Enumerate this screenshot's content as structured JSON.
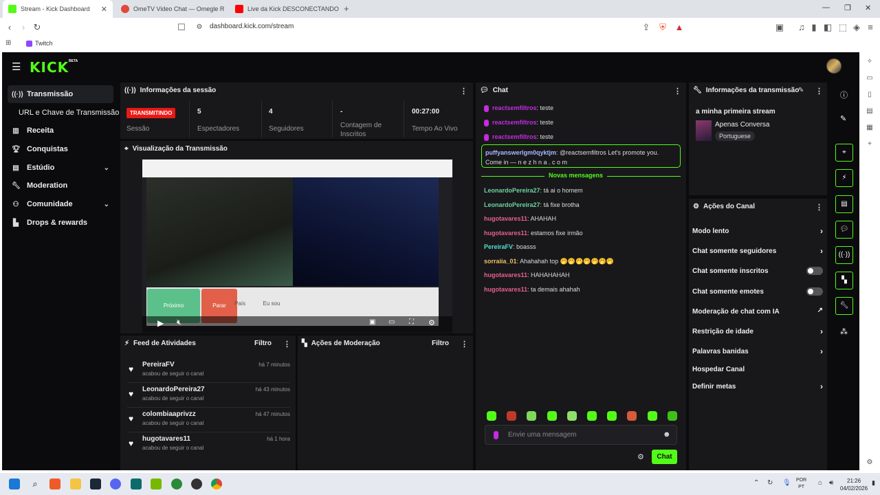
{
  "browser": {
    "tabs": [
      {
        "title": "Stream - Kick Dashboard",
        "active": true
      },
      {
        "title": "OmeTV Video Chat — Omegle R",
        "active": false
      },
      {
        "title": "Live da Kick DESCONECTANDO ou T",
        "active": false
      }
    ],
    "new_tab": "+",
    "url": "dashboard.kick.com/stream",
    "bookmark": "Twitch"
  },
  "app": {
    "logo": "KICK",
    "beta": "BETA"
  },
  "sidebar": {
    "items": [
      {
        "label": "Transmissão",
        "icon": "broadcast-icon"
      },
      {
        "label": "URL e Chave de Transmissão",
        "icon": ""
      },
      {
        "label": "Receita",
        "icon": "chart-icon"
      },
      {
        "label": "Conquistas",
        "icon": "trophy-icon"
      },
      {
        "label": "Estúdio",
        "icon": "studio-icon"
      },
      {
        "label": "Moderation",
        "icon": "wrench-icon"
      },
      {
        "label": "Comunidade",
        "icon": "community-icon"
      },
      {
        "label": "Drops & rewards",
        "icon": "drops-icon"
      }
    ]
  },
  "session": {
    "title": "Informações da sessão",
    "status_badge": "TRANSMITINDO",
    "status_label": "Sessão",
    "stats": [
      {
        "value": "5",
        "label": "Espectadores"
      },
      {
        "value": "4",
        "label": "Seguidores"
      },
      {
        "value": "-",
        "label": "Contagem de Inscritos"
      },
      {
        "value": "00:27:00",
        "label": "Tempo Ao Vivo"
      }
    ]
  },
  "preview": {
    "title": "Visualização da Transmissão",
    "buttons": [
      "Próximo",
      "Parar",
      "País",
      "Eu sou"
    ]
  },
  "activity": {
    "title": "Feed de Atividades",
    "filter": "Filtro",
    "items": [
      {
        "name": "PereiraFV",
        "desc": "acabou de seguir o canal",
        "time": "há 7 minutos"
      },
      {
        "name": "LeonardoPereira27",
        "desc": "acabou de seguir o canal",
        "time": "há 43 minutos"
      },
      {
        "name": "colombiaaprivzz",
        "desc": "acabou de seguir o canal",
        "time": "há 47 minutos"
      },
      {
        "name": "hugotavares11",
        "desc": "acabou de seguir o canal",
        "time": "há 1 hora"
      }
    ]
  },
  "moderation": {
    "title": "Ações de Moderação",
    "filter": "Filtro"
  },
  "chat": {
    "title": "Chat",
    "messages_top": [
      {
        "user": "reactsemfiltros",
        "text": "teste"
      },
      {
        "user": "reactsemfiltros",
        "text": "teste"
      },
      {
        "user": "reactsemfiltros",
        "text": "teste"
      }
    ],
    "highlight": {
      "user": "puffyanswerlgm0qyktjm",
      "text": "@reactsemfiltros Let's promote you.",
      "text2": "Come in — n e z h n a . c o m"
    },
    "divider": "Novas mensagens",
    "messages": [
      {
        "user": "LeonardoPereira27",
        "text": "tá ai o homem",
        "color": "#6fd0a0"
      },
      {
        "user": "LeonardoPereira27",
        "text": "tá fixe brotha",
        "color": "#6fd0a0"
      },
      {
        "user": "hugotavares11",
        "text": "AHAHAH",
        "color": "#e8608a"
      },
      {
        "user": "hugotavares11",
        "text": "estamos fixe irmão",
        "color": "#e8608a"
      },
      {
        "user": "PereiraFV",
        "text": "boasss",
        "color": "#53e0d0"
      },
      {
        "user": "sorraiia_01",
        "text": "Ahahahah top 🤭🤭🤭🤭🤭🤭🤭",
        "color": "#f0c060"
      },
      {
        "user": "hugotavares11",
        "text": "HAHAHAHAH",
        "color": "#e8608a"
      },
      {
        "user": "hugotavares11",
        "text": "ta demais ahahah",
        "color": "#e8608a"
      }
    ],
    "input_placeholder": "Envie uma mensagem",
    "send_label": "Chat"
  },
  "stream_info": {
    "title": "Informações da transmissão",
    "stream_title": "a minha primeira stream",
    "category": "Apenas Conversa",
    "language": "Portuguese"
  },
  "channel_actions": {
    "title": "Ações do Canal",
    "items": [
      {
        "label": "Modo lento",
        "control": "chevron"
      },
      {
        "label": "Chat somente seguidores",
        "control": "chevron"
      },
      {
        "label": "Chat somente inscritos",
        "control": "toggle"
      },
      {
        "label": "Chat somente emotes",
        "control": "toggle"
      },
      {
        "label": "Moderação de chat com IA",
        "control": "external"
      },
      {
        "label": "Restrição de idade",
        "control": "chevron"
      },
      {
        "label": "Palavras banidas",
        "control": "chevron"
      },
      {
        "label": "Hospedar Canal",
        "control": "none"
      },
      {
        "label": "Definir metas",
        "control": "chevron"
      }
    ]
  },
  "taskbar": {
    "lang_top": "POR",
    "lang_bottom": "PT",
    "time": "21:26",
    "date": "04/02/2026"
  },
  "colors": {
    "brand": "#53fc18",
    "live": "#e91916",
    "panel": "#18181b",
    "background": "#0b0b0d"
  }
}
